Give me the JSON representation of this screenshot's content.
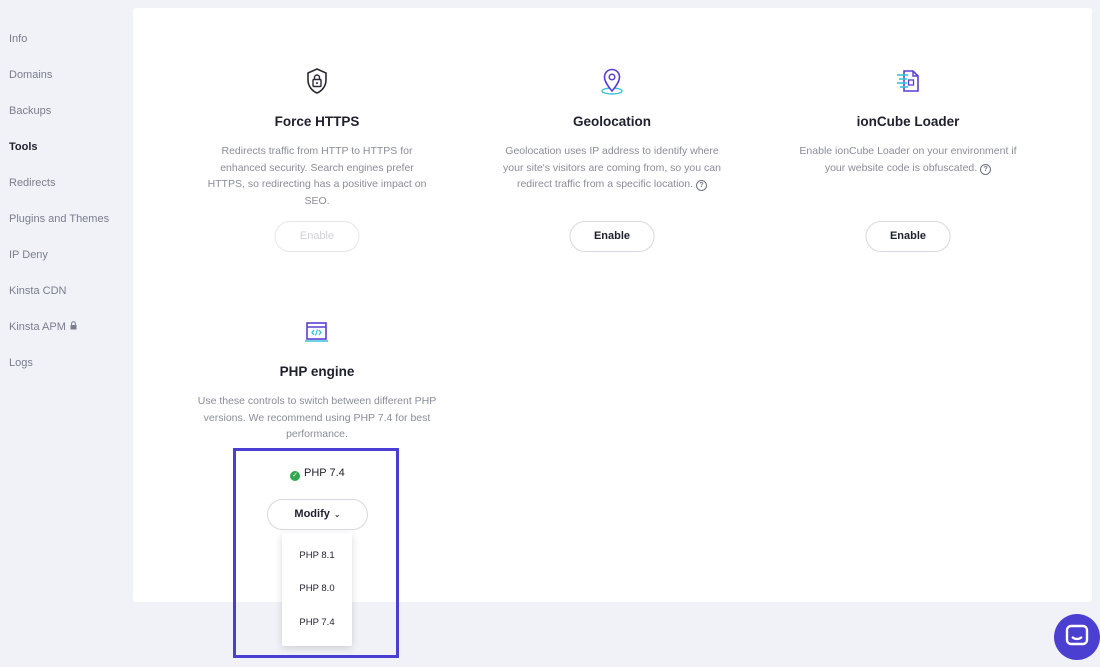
{
  "sidebar": {
    "items": [
      {
        "label": "Info"
      },
      {
        "label": "Domains"
      },
      {
        "label": "Backups"
      },
      {
        "label": "Tools"
      },
      {
        "label": "Redirects"
      },
      {
        "label": "Plugins and Themes"
      },
      {
        "label": "IP Deny"
      },
      {
        "label": "Kinsta CDN"
      },
      {
        "label": "Kinsta APM"
      },
      {
        "label": "Logs"
      }
    ],
    "active_item": "Tools",
    "apm_icon": "lock-icon"
  },
  "tools": {
    "force_https": {
      "title": "Force HTTPS",
      "description": "Redirects traffic from HTTP to HTTPS for enhanced security. Search engines prefer HTTPS, so redirecting has a positive impact on SEO.",
      "button_label": "Enable",
      "button_disabled": true,
      "icon": "shield-lock-icon"
    },
    "geolocation": {
      "title": "Geolocation",
      "description": "Geolocation uses IP address to identify where your site's visitors are coming from, so you can redirect traffic from a specific location.",
      "button_label": "Enable",
      "icon": "location-pin-icon"
    },
    "ioncube": {
      "title": "ionCube Loader",
      "description": "Enable ionCube Loader on your environment if your website code is obfuscated.",
      "button_label": "Enable",
      "icon": "cube-document-icon"
    },
    "php_engine": {
      "title": "PHP engine",
      "description": "Use these controls to switch between different PHP versions. We recommend using PHP 7.4 for best performance.",
      "current_version": "PHP 7.4",
      "modify_label": "Modify",
      "options": [
        "PHP 8.1",
        "PHP 8.0",
        "PHP 7.4"
      ],
      "icon": "code-window-icon"
    }
  },
  "help_glyph": "?",
  "colors": {
    "accent": "#4b3fd1",
    "success": "#2fa84f",
    "muted_text": "#8a8c9b"
  }
}
